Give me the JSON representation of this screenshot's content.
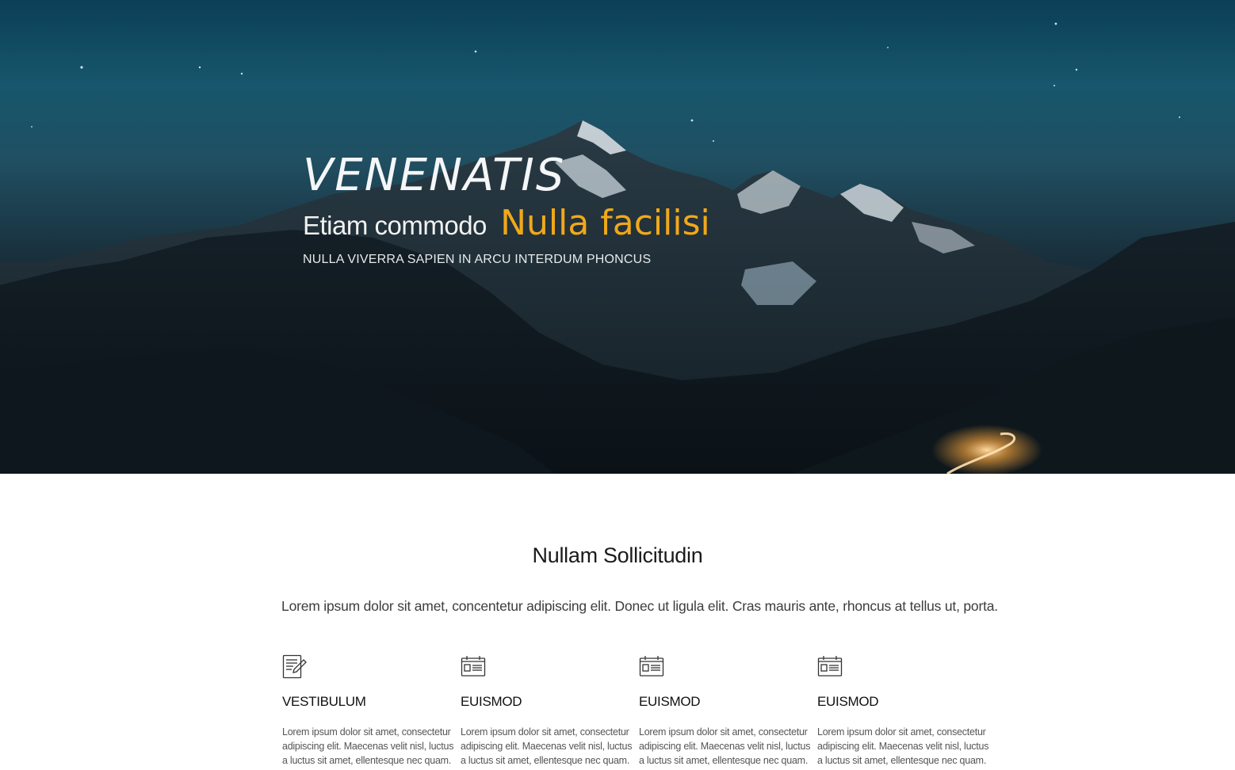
{
  "hero": {
    "title": "VENENATIS",
    "subtitle_plain": "Etiam commodo",
    "subtitle_accent": "Nulla facilisi",
    "tagline": "NULLA VIVERRA SAPIEN IN ARCU INTERDUM PHONCUS",
    "accent_color": "#f0a81a"
  },
  "intro": {
    "heading": "Nullam Sollicitudin",
    "text": "Lorem ipsum dolor sit amet, concentetur adipiscing elit. Donec ut ligula elit. Cras mauris ante, rhoncus at tellus ut, porta."
  },
  "features": [
    {
      "icon": "edit-document-icon",
      "title": "VESTIBULUM",
      "text": "Lorem ipsum dolor sit amet, consectetur adipiscing elit. Maecenas velit nisl, luctus a luctus sit amet, ellentesque nec quam."
    },
    {
      "icon": "calendar-card-icon",
      "title": "EUISMOD",
      "text": "Lorem ipsum dolor sit amet, consectetur adipiscing elit. Maecenas velit nisl, luctus a luctus sit amet, ellentesque nec quam."
    },
    {
      "icon": "calendar-card-icon",
      "title": "EUISMOD",
      "text": "Lorem ipsum dolor sit amet, consectetur adipiscing elit. Maecenas velit nisl, luctus a luctus sit amet, ellentesque nec quam."
    },
    {
      "icon": "calendar-card-icon",
      "title": "EUISMOD",
      "text": "Lorem ipsum dolor sit amet, consectetur adipiscing elit. Maecenas velit nisl, luctus a luctus sit amet, ellentesque nec quam."
    }
  ]
}
